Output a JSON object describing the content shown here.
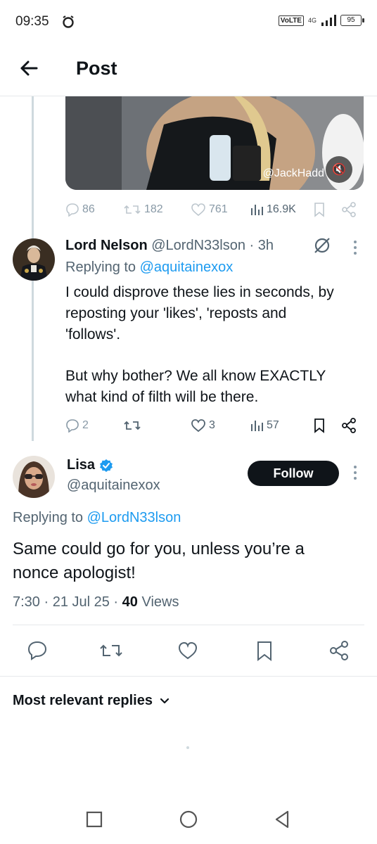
{
  "status_bar": {
    "time": "09:35",
    "volte": "VoLTE",
    "network": "4G",
    "battery": "95"
  },
  "header": {
    "title": "Post"
  },
  "media": {
    "watermark": "@JackHadd"
  },
  "original_post": {
    "replies": "86",
    "reposts": "182",
    "likes": "761",
    "views": "16.9K"
  },
  "reply": {
    "name": "Lord Nelson",
    "handle_time": "@LordN33lson · 3h",
    "replying_prefix": "Replying to",
    "replying_to": "@aquitainexox",
    "body_lines": [
      "I could disprove these lies in seconds, by",
      "reposting your 'likes', 'reposts and",
      "'follows'.",
      "",
      "But why bother? We all know EXACTLY",
      "what kind of filth will be there."
    ],
    "replies": "2",
    "likes": "3",
    "views": "57"
  },
  "main_post": {
    "name": "Lisa",
    "handle": "@aquitainexox",
    "follow_label": "Follow",
    "replying_prefix": "Replying to",
    "replying_to": "@LordN33lson",
    "body_lines": [
      "Same could go for you, unless you’re a",
      "nonce apologist!"
    ],
    "time": "7:30 · 21 Jul 25 · ",
    "views_count": "40",
    "views_label": " Views"
  },
  "replies_sort": {
    "label": "Most relevant replies"
  },
  "colors": {
    "link": "#1d9bf0",
    "verified": "#1d9bf0",
    "text": "#0f1419",
    "muted": "#536471"
  }
}
